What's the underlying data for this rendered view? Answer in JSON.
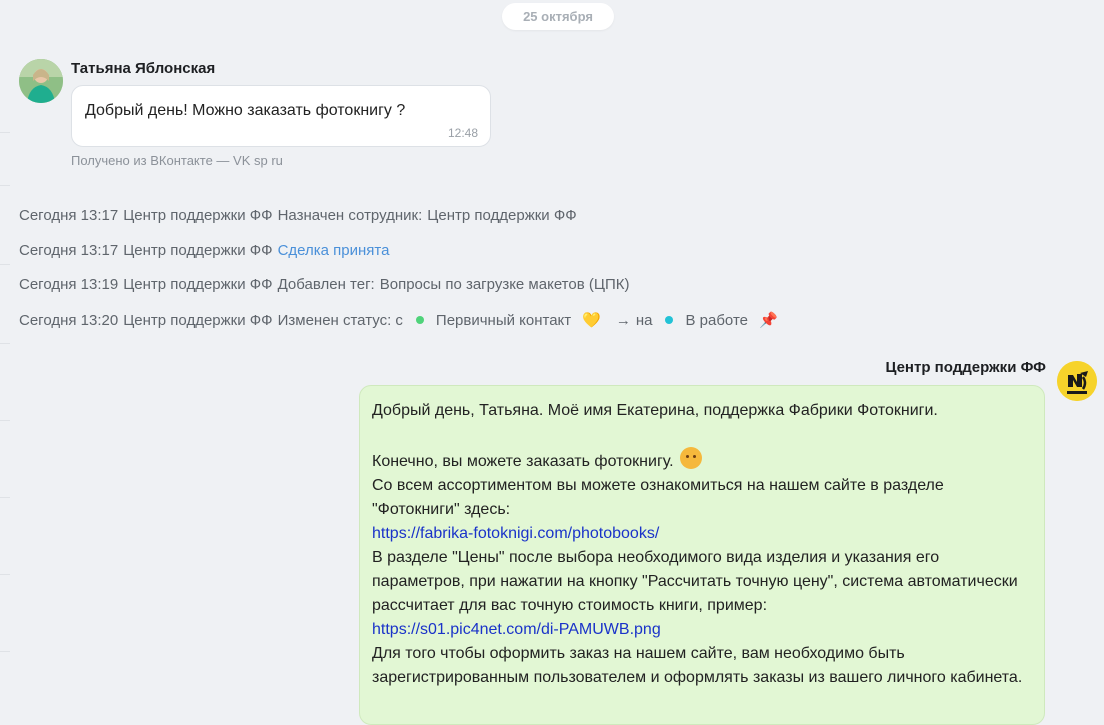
{
  "date_divider": "25 октября",
  "client": {
    "name": "Татьяна Яблонская",
    "message": "Добрый день! Можно заказать фотокнигу ?",
    "time": "12:48",
    "source": "Получено из ВКонтакте — VK sp ru"
  },
  "events": [
    {
      "time": "Сегодня 13:17",
      "actor": "Центр поддержки ФФ",
      "action": "Назначен сотрудник:",
      "value": "Центр поддержки ФФ"
    },
    {
      "time": "Сегодня 13:17",
      "actor": "Центр поддержки ФФ",
      "link": "Сделка принята"
    },
    {
      "time": "Сегодня 13:19",
      "actor": "Центр поддержки ФФ",
      "action": "Добавлен тег:",
      "value": "Вопросы по загрузке макетов (ЦПК)"
    },
    {
      "time": "Сегодня 13:20",
      "actor": "Центр поддержки ФФ",
      "action": "Изменен статус: с",
      "from_status": "Первичный контакт",
      "from_emoji": "💛",
      "arrow": "→",
      "to_word": "на",
      "to_status": "В работе",
      "to_emoji": "📌"
    }
  ],
  "agent": {
    "name": "Центр поддержки ФФ",
    "lines": [
      "Добрый день, Татьяна. Моё имя Екатерина, поддержка Фабрики Фотокниги.",
      "Конечно, вы можете заказать фотокнигу.",
      "Со всем ассортиментом вы можете ознакомиться на нашем сайте в разделе \"Фотокниги\" здесь:",
      "https://fabrika-fotoknigi.com/photobooks/",
      "В разделе \"Цены\" после выбора необходимого вида изделия и указания его параметров, при нажатии на кнопку \"Рассчитать точную цену\", система автоматически рассчитает для вас точную стоимость книги, пример:",
      "https://s01.pic4net.com/di-PAMUWB.png",
      "Для того чтобы оформить заказ на нашем сайте, вам необходимо быть зарегистрированным пользователем и оформлять заказы из вашего личного кабинета."
    ]
  },
  "colors": {
    "background": "#eff1f4",
    "outgoing_bubble": "#e2f7d4",
    "link": "#1a33c9",
    "event_link": "#4a90d9",
    "status_green": "#4fd37a",
    "status_cyan": "#22c2d6",
    "agent_avatar": "#f6d32b"
  }
}
